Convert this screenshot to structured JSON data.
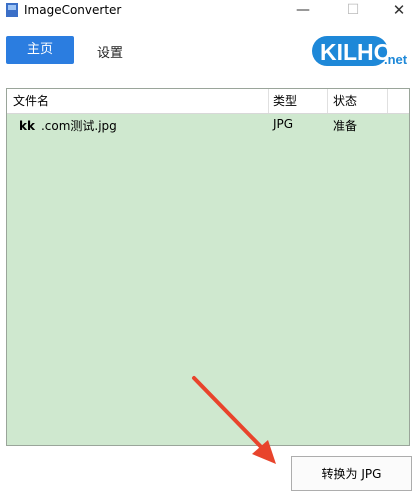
{
  "window": {
    "title": "ImageConverter",
    "min": "—",
    "max": "☐",
    "close": "✕"
  },
  "tabs": {
    "home": "主页",
    "settings": "设置"
  },
  "logo": {
    "main": "KILHO",
    "suffix": ".net"
  },
  "list": {
    "headers": [
      "文件名",
      "类型",
      "状态"
    ],
    "rows": [
      {
        "prefix": "kk",
        "name": ".com测试.jpg",
        "type": "JPG",
        "status": "准备"
      }
    ]
  },
  "actions": {
    "convert": "转换为 JPG"
  },
  "colors": {
    "accent": "#2b7de0",
    "list_bg": "#cfe8cf",
    "arrow": "#e8442c",
    "logo": "#1e88d8"
  }
}
